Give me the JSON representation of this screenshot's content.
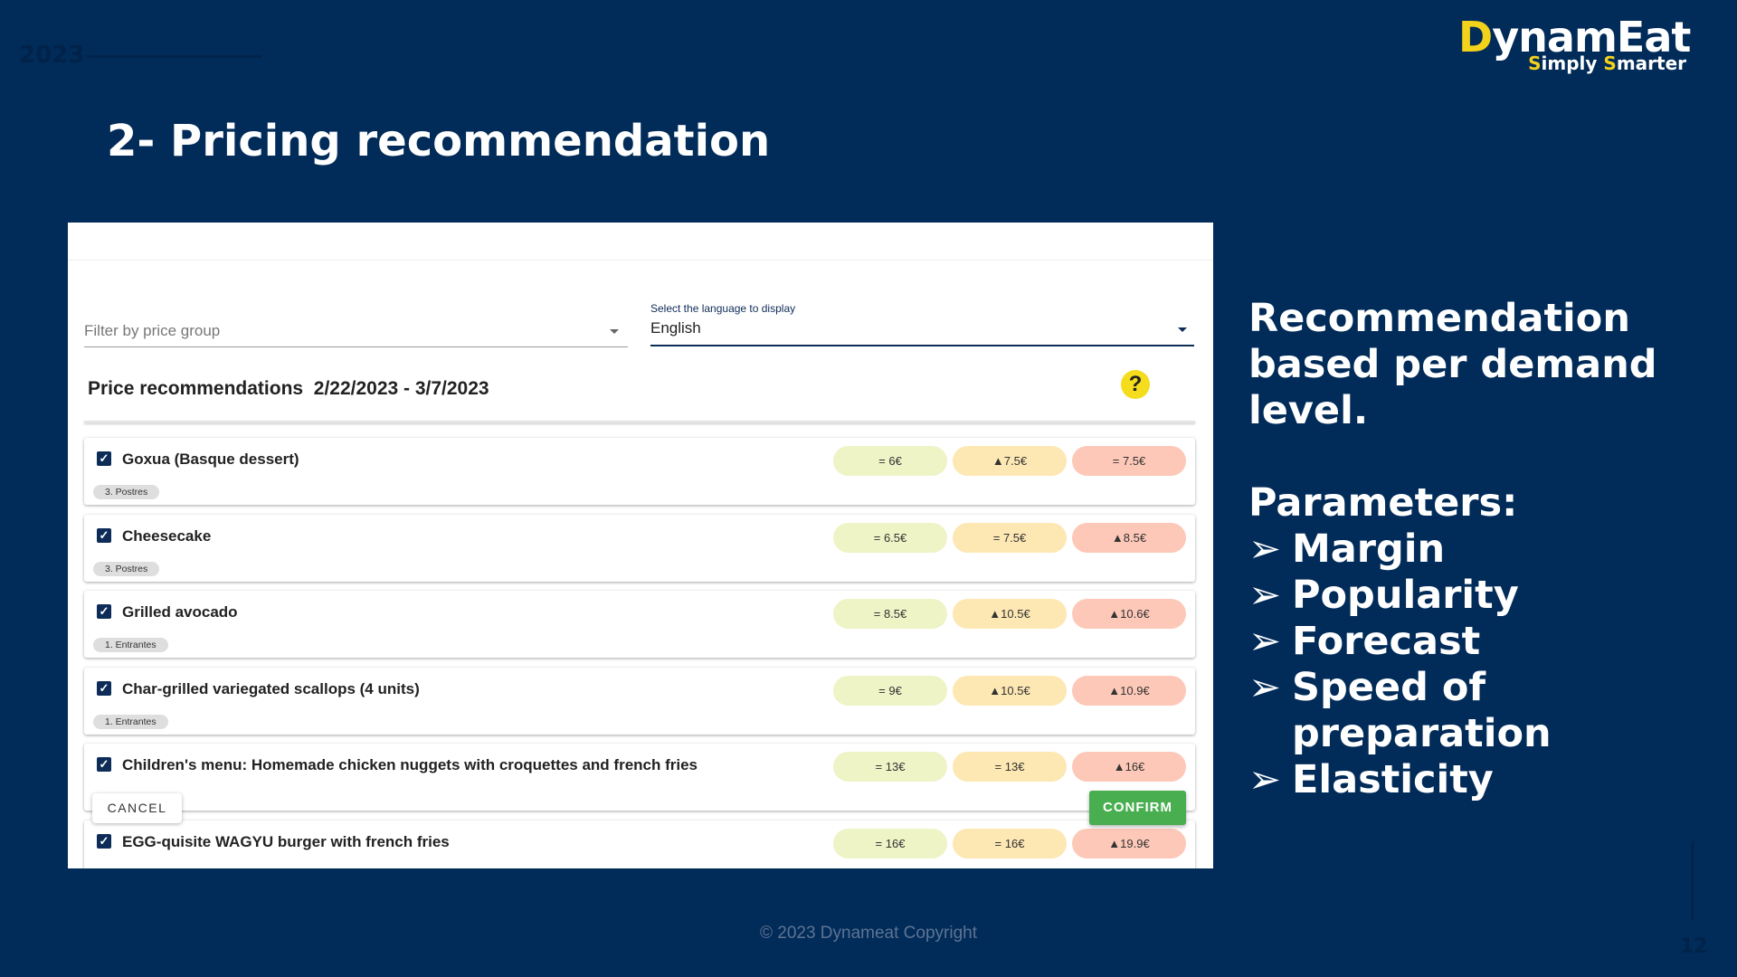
{
  "slide": {
    "year": "2023",
    "title": "2- Pricing recommendation",
    "footer": "© 2023 Dynameat Copyright",
    "page_number": "12",
    "background_color": "#012b58"
  },
  "logo": {
    "brand": "DynamEat",
    "tagline": "Simply Smarter",
    "accent_color": "#f2d21b"
  },
  "app": {
    "filter": {
      "placeholder": "Filter by price group"
    },
    "language": {
      "label": "Select the language to display",
      "value": "English"
    },
    "heading": "Price recommendations",
    "date_range": "2/22/2023 - 3/7/2023",
    "help_icon": "?",
    "cancel_label": "CANCEL",
    "confirm_label": "CONFIRM",
    "pill_colors": [
      "#eef4c6",
      "#fde7b3",
      "#fdc8b8"
    ],
    "items": [
      {
        "name": "Goxua (Basque dessert)",
        "group": "3. Postres",
        "checked": true,
        "prices": [
          "= 6€",
          "▲7.5€",
          "= 7.5€"
        ]
      },
      {
        "name": "Cheesecake",
        "group": "3. Postres",
        "checked": true,
        "prices": [
          "= 6.5€",
          "= 7.5€",
          "▲8.5€"
        ]
      },
      {
        "name": "Grilled avocado",
        "group": "1. Entrantes",
        "checked": true,
        "prices": [
          "= 8.5€",
          "▲10.5€",
          "▲10.6€"
        ]
      },
      {
        "name": "Char-grilled variegated scallops (4 units)",
        "group": "1. Entrantes",
        "checked": true,
        "prices": [
          "= 9€",
          "▲10.5€",
          "▲10.9€"
        ]
      },
      {
        "name": "Children's menu: Homemade chicken nuggets with croquettes and french fries",
        "group": "",
        "checked": true,
        "prices": [
          "= 13€",
          "= 13€",
          "▲16€"
        ]
      },
      {
        "name": "EGG-quisite WAGYU burger with french fries",
        "group": "",
        "checked": true,
        "prices": [
          "= 16€",
          "= 16€",
          "▲19.9€"
        ]
      }
    ]
  },
  "side": {
    "intro": [
      "Recommendation",
      "based per demand",
      "level."
    ],
    "params_title": "Parameters:",
    "bullet_icon": "➢",
    "params": [
      "Margin",
      "Popularity",
      "Forecast",
      "Speed of preparation",
      "Elasticity"
    ]
  }
}
